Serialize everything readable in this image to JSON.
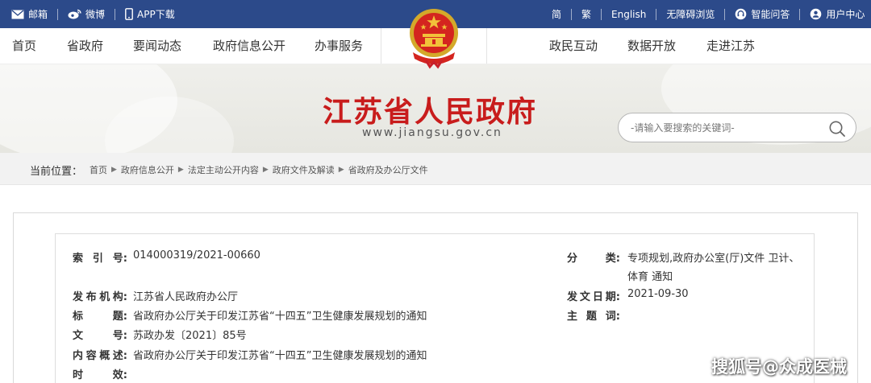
{
  "topbar": {
    "mail": {
      "icon": "mail-icon",
      "label": "邮箱"
    },
    "weibo": {
      "icon": "weibo-icon",
      "label": "微博"
    },
    "app": {
      "icon": "mobile-icon",
      "label": "APP下载"
    },
    "simplified": "简",
    "traditional": "繁",
    "english": "English",
    "accessibility": "无障碍浏览",
    "qa": {
      "icon": "headset-icon",
      "label": "智能问答"
    },
    "user": {
      "icon": "user-icon",
      "label": "用户中心"
    }
  },
  "nav": {
    "home": "首页",
    "gov": "省政府",
    "news": "要闻动态",
    "disclosure": "政府信息公开",
    "services": "办事服务",
    "interaction": "政民互动",
    "open_data": "数据开放",
    "about": "走进江苏"
  },
  "banner": {
    "title": "江苏省人民政府",
    "url": "www.jiangsu.gov.cn"
  },
  "search": {
    "placeholder": "-请输入要搜索的关键词-",
    "icon": "search-icon"
  },
  "breadcrumb": {
    "label": "当前位置：",
    "items": [
      "首页",
      "政府信息公开",
      "法定主动公开内容",
      "政府文件及解读",
      "省政府及办公厅文件"
    ]
  },
  "meta": {
    "index_label": "索引号:",
    "index_value": "014000319/2021-00660",
    "category_label": "分类:",
    "category_value_1": "专项规划,政府办公室(厅)文件 卫计、",
    "category_value_2": "体育 通知",
    "issuer_label": "发布机构:",
    "issuer_value": "江苏省人民政府办公厅",
    "date_label": "发文日期:",
    "date_value": "2021-09-30",
    "title_label": "标题:",
    "title_value": "省政府办公厅关于印发江苏省“十四五”卫生健康发展规划的通知",
    "subject_label": "主题词:",
    "subject_value": "",
    "docno_label": "文号:",
    "docno_value": "苏政办发〔2021〕85号",
    "summary_label": "内容概述:",
    "summary_value": "省政府办公厅关于印发江苏省“十四五”卫生健康发展规划的通知",
    "validity_label": "时效:",
    "validity_value": ""
  },
  "watermark": "搜狐号@众成医械",
  "colors": {
    "topbar_bg": "#2c4a8a",
    "title_red": "#c81c1c",
    "breadcrumb_bg": "#f2f2f2"
  }
}
